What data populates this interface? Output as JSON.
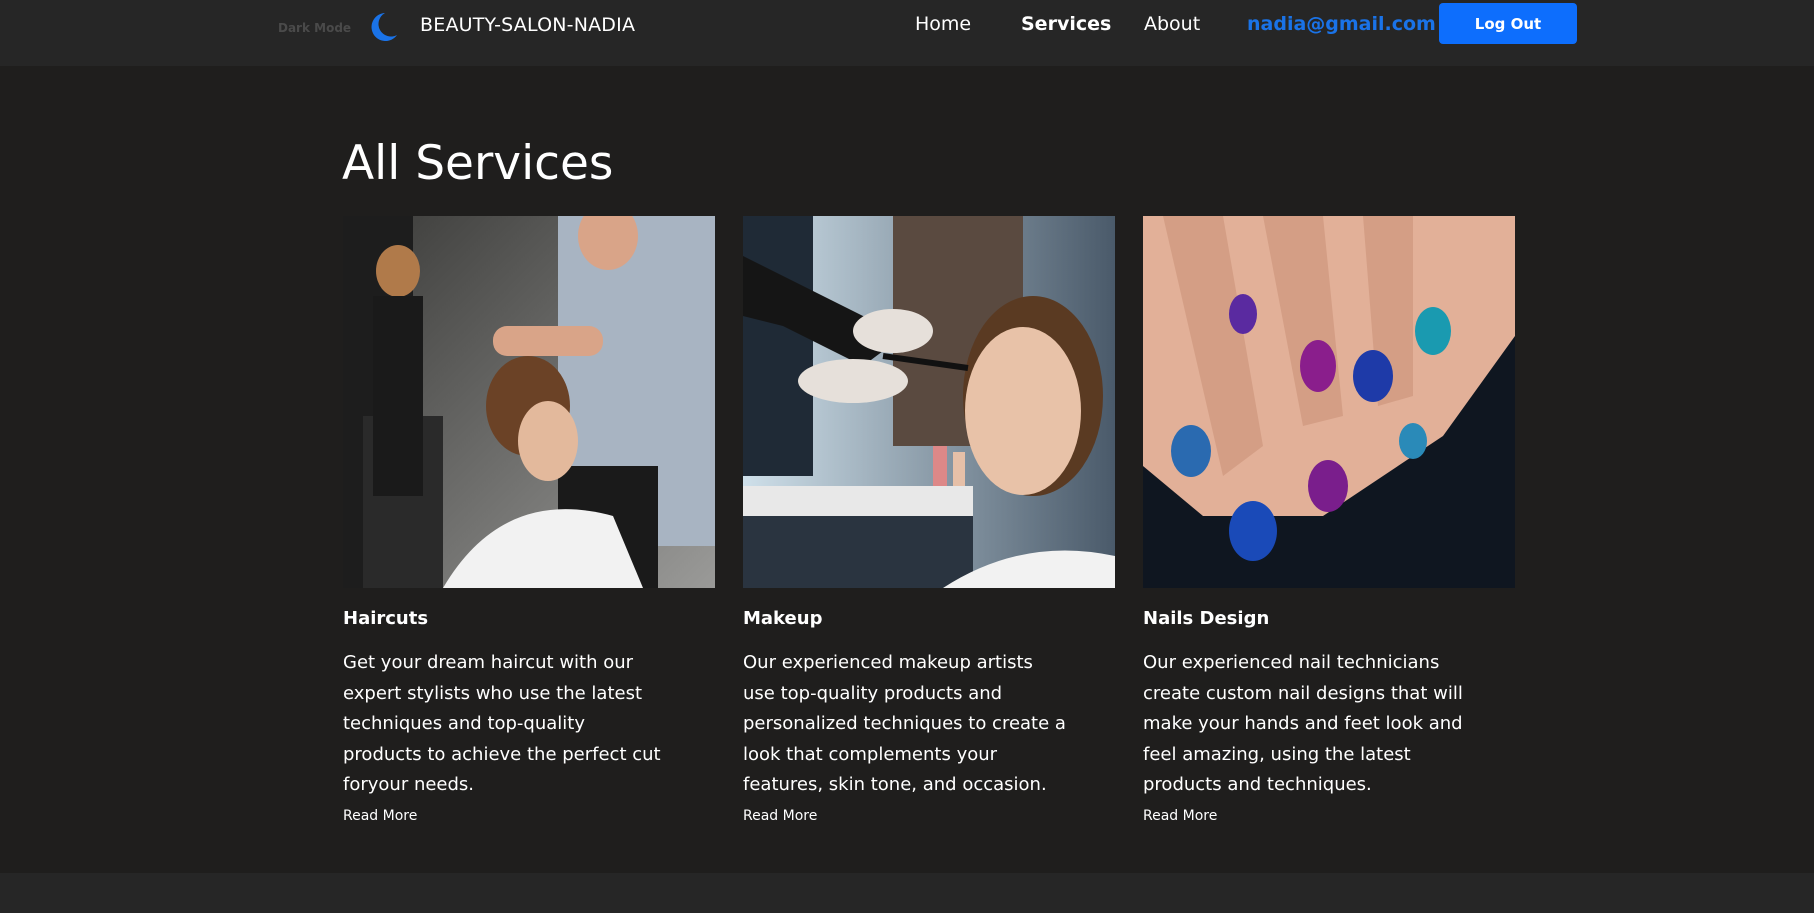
{
  "navbar": {
    "dark_mode_label": "Dark Mode",
    "toggle_icon": "moon-icon",
    "brand": "BEAUTY-SALON-NADIA",
    "links": [
      {
        "label": "Home",
        "active": false
      },
      {
        "label": "Services",
        "active": true
      },
      {
        "label": "About",
        "active": false
      }
    ],
    "user_email": "nadia@gmail.com",
    "logout_label": "Log Out"
  },
  "main": {
    "title": "All Services",
    "cards": [
      {
        "title": "Haircuts",
        "description": "Get your dream haircut with our expert stylists who use the latest techniques and top-quality products to achieve the perfect cut foryour needs.",
        "link_label": "Read More",
        "image": "haircut-photo"
      },
      {
        "title": "Makeup",
        "description": "Our experienced makeup artists use top-quality products and personalized techniques to create a look that complements your features, skin tone, and occasion.",
        "link_label": "Read More",
        "image": "makeup-photo"
      },
      {
        "title": "Nails Design",
        "description": "Our experienced nail technicians create custom nail designs that will make your hands and feet look and feel amazing, using the latest products and techniques.",
        "link_label": "Read More",
        "image": "nails-photo"
      }
    ]
  },
  "colors": {
    "background": "#1f1e1d",
    "navbar": "#262626",
    "accent": "#0d6efd",
    "email": "#1a73e8"
  }
}
